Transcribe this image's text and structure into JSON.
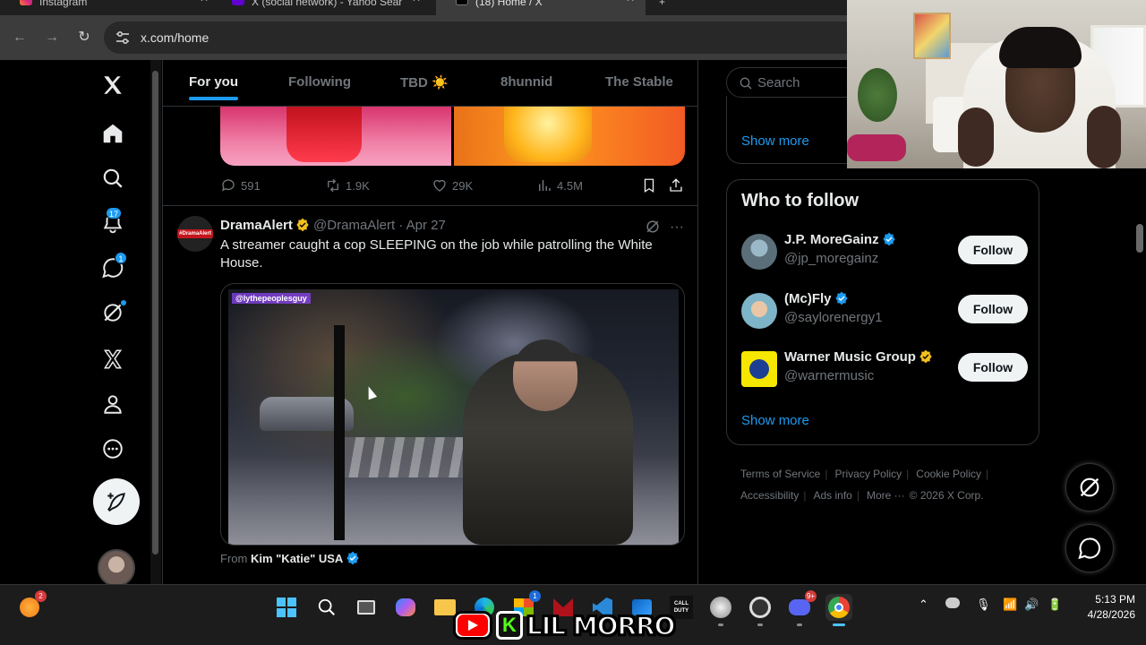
{
  "browser": {
    "tabs": [
      {
        "title": "Instagram",
        "active": false
      },
      {
        "title": "X (social network) - Yahoo Sear",
        "active": false
      },
      {
        "title": "(18) Home / X",
        "active": true
      }
    ],
    "url": "x.com/home"
  },
  "nav": {
    "notifications_badge": "17",
    "messages_badge": "1"
  },
  "feed_tabs": [
    "For you",
    "Following",
    "TBD ☀️",
    "8hunnid",
    "The Stable"
  ],
  "prev_post": {
    "replies": "591",
    "reposts": "1.9K",
    "likes": "29K",
    "views": "4.5M"
  },
  "post": {
    "avatar_text": "#DramaAlert",
    "name": "DramaAlert",
    "handle": "@DramaAlert",
    "date": "· Apr 27",
    "text": "A streamer caught a cop SLEEPING on the job while patrolling the White House.",
    "video_tag": "@lythepeoplesguy",
    "from_label": "From",
    "from_name": "Kim \"Katie\" USA"
  },
  "sidebar": {
    "search_placeholder": "Search",
    "show_more_1": "Show more",
    "who_to_follow_title": "Who to follow",
    "accounts": [
      {
        "name": "J.P. MoreGainz",
        "handle": "@jp_moregainz",
        "button": "Follow",
        "check": "blue"
      },
      {
        "name": "(Mc)Fly",
        "handle": "@saylorenergy1",
        "button": "Follow",
        "check": "blue"
      },
      {
        "name": "Warner Music Group",
        "handle": "@warnermusic",
        "button": "Follow",
        "check": "gold"
      }
    ],
    "show_more_2": "Show more",
    "footer_links": [
      "Terms of Service",
      "Privacy Policy",
      "Cookie Policy",
      "Accessibility",
      "Ads info",
      "More ···",
      "© 2026 X Corp."
    ]
  },
  "taskbar": {
    "weather_badge": "2",
    "store_badge": "1",
    "discord_badge": "9+",
    "time": "5:13 PM",
    "date": "4/28/2026"
  },
  "overlay": {
    "channel_name": "LIL MORRO"
  },
  "colors": {
    "accent": "#1d9bf0",
    "background": "#000000",
    "muted": "#71767b",
    "text": "#e7e9ea",
    "gold_check": "#f4c01e"
  }
}
